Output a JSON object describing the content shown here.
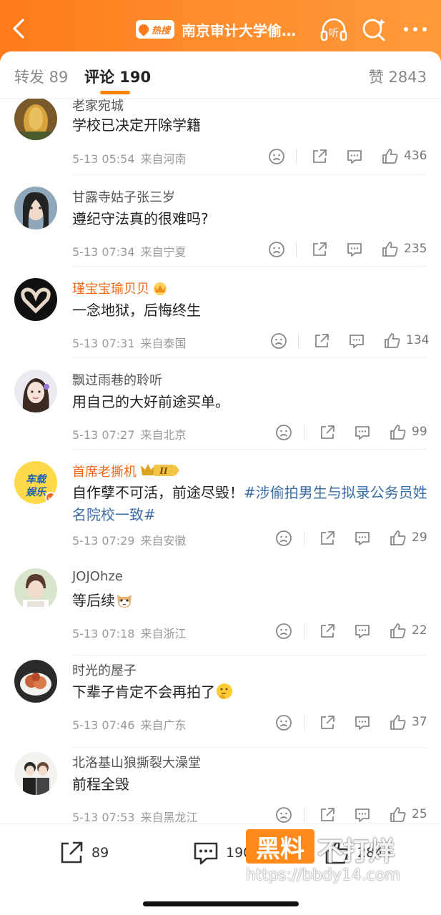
{
  "header": {
    "hot_label": "热搜",
    "title": "南京审计大学偷…",
    "listen_label": "听",
    "colors": {
      "header": "#ff8a2a",
      "accent": "#ff8200",
      "vip_name": "#ee6a18",
      "topic": "#3b6ea5"
    }
  },
  "tabs": {
    "repost": "转发 89",
    "comment": "评论 190",
    "like": "赞 2843"
  },
  "comments": [
    {
      "name": "老家宛城",
      "text": "学校已决定开除学籍",
      "time": "5-13 05:54",
      "loc": "来自河南",
      "likes": "436",
      "vip": false
    },
    {
      "name": "甘露寺姑子张三岁",
      "text": "遵纪守法真的很难吗?",
      "time": "5-13 07:34",
      "loc": "来自宁夏",
      "likes": "235",
      "vip": false
    },
    {
      "name": "瑾宝宝瑜贝贝",
      "text": "一念地狱，后悔终生",
      "time": "5-13 07:31",
      "loc": "来自泰国",
      "likes": "134",
      "vip": true
    },
    {
      "name": "飘过雨巷的聆听",
      "text": "用自己的大好前途买单。",
      "time": "5-13 07:27",
      "loc": "来自北京",
      "likes": "99",
      "vip": false
    },
    {
      "name": "首席老撕机",
      "text": "自作孽不可活，前途尽毁！",
      "topic": "#涉偷拍男生与拟录公务员姓名院校一致#",
      "time": "5-13 07:29",
      "loc": "来自安徽",
      "likes": "29",
      "vip": true,
      "avatar_text": "车载娱乐",
      "level_badge": "II"
    },
    {
      "name": "JOJOhze",
      "text": "等后续",
      "time": "5-13 07:18",
      "loc": "来自浙江",
      "likes": "22",
      "vip": false,
      "emoji": "cat-face"
    },
    {
      "name": "时光的屋子",
      "text": "下辈子肯定不会再拍了",
      "time": "5-13 07:46",
      "loc": "来自广东",
      "likes": "37",
      "vip": false,
      "emoji": "thinking-face"
    },
    {
      "name": "北洛基山狼撕裂大澡堂",
      "text": "前程全毁",
      "time": "5-13 07:53",
      "loc": "来自黑龙江",
      "likes": "25",
      "vip": false
    }
  ],
  "bottom": {
    "repost_count": "89",
    "comment_count": "190",
    "like_count": "2843"
  },
  "watermark": {
    "box": "黑料",
    "rest": "不打烊",
    "url": "https://bbdy14.com"
  }
}
